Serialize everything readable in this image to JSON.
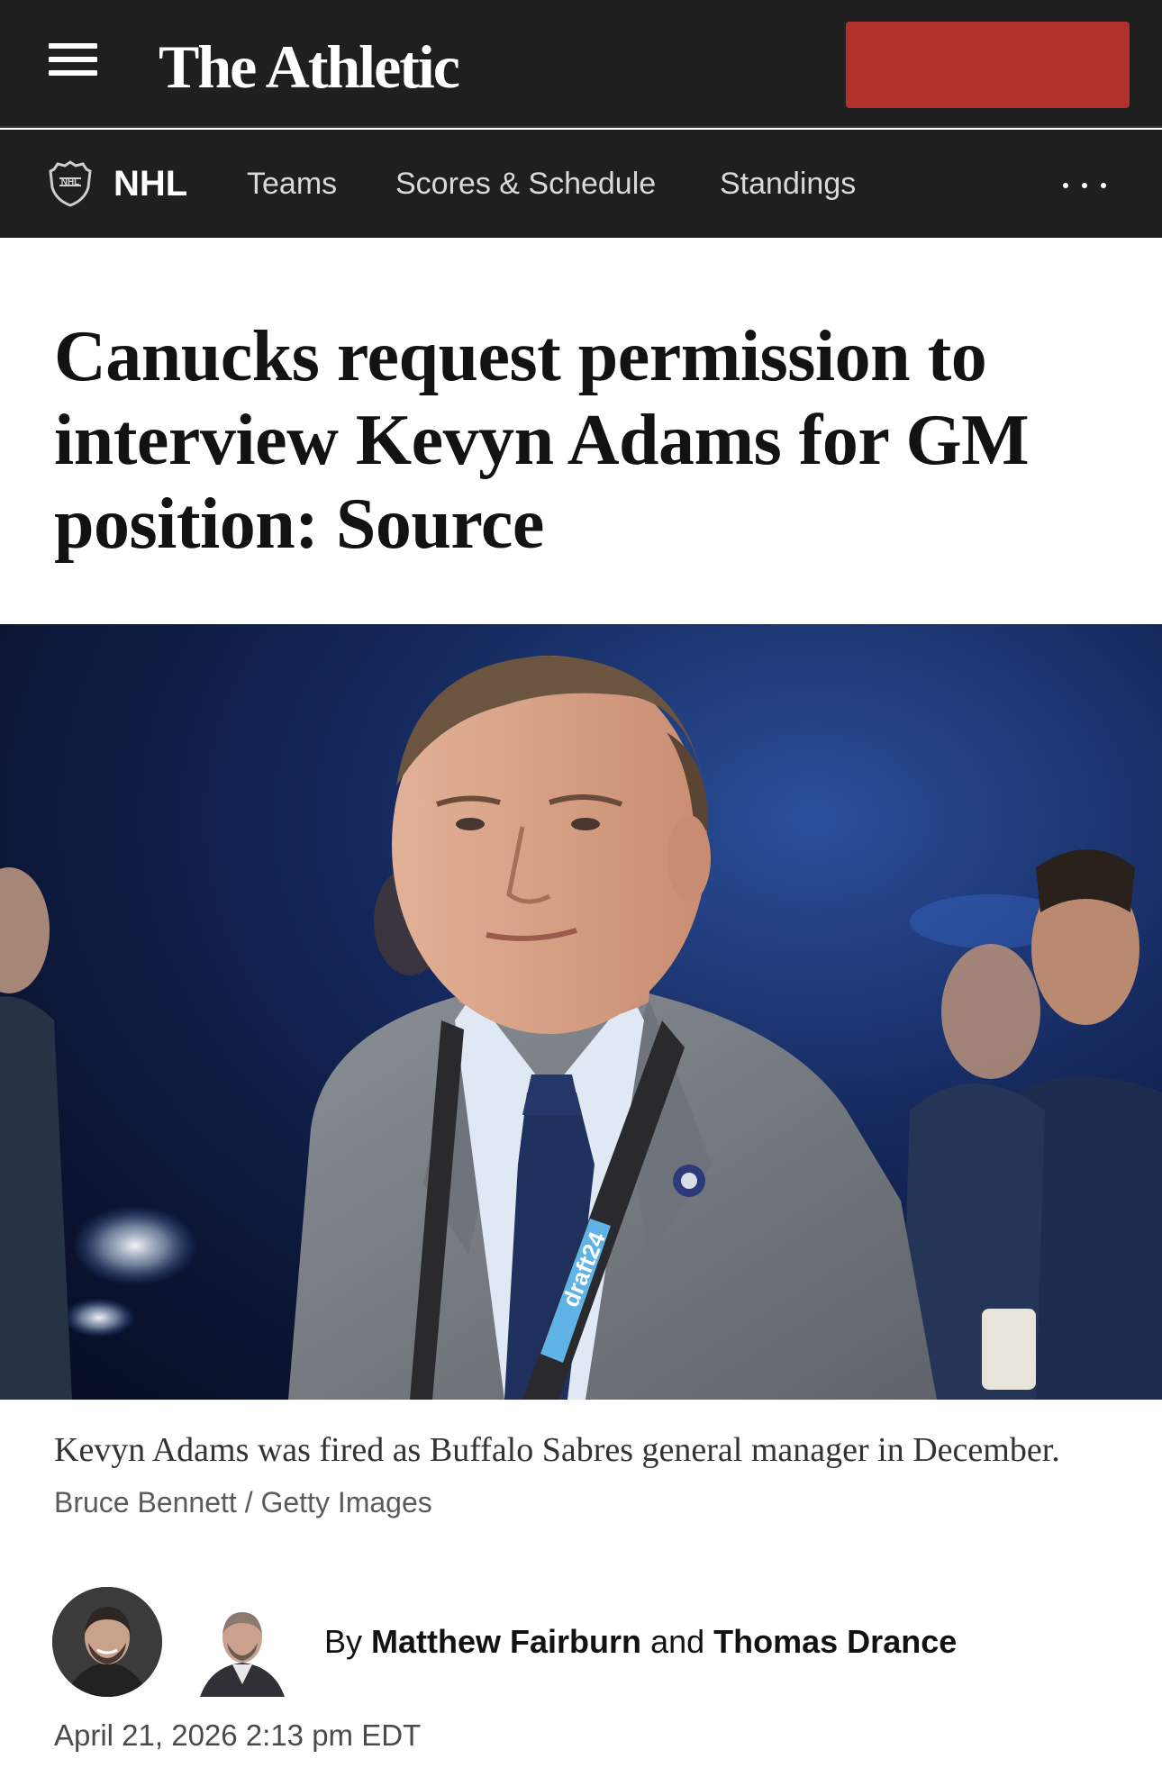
{
  "header": {
    "logo_text": "The Athletic",
    "menu_icon": "hamburger-menu-icon",
    "cta_color": "#b3312c"
  },
  "subnav": {
    "league_icon": "nhl-shield-icon",
    "league": "NHL",
    "items": [
      {
        "label": "Teams"
      },
      {
        "label": "Scores & Schedule"
      },
      {
        "label": "Standings"
      }
    ],
    "more_icon": "more-dots-icon"
  },
  "article": {
    "headline": "Canucks request permission to interview Kevyn Adams for GM position: Source",
    "photo": {
      "caption": "Kevyn Adams was fired as Buffalo Sabres general manager in December.",
      "credit": "Bruce Bennett / Getty Images",
      "lanyard_text": "draft24"
    },
    "byline": {
      "prefix": "By",
      "author1": "Matthew Fairburn",
      "conjunction": "and",
      "author2": "Thomas Drance"
    },
    "timestamp": "April 21, 2026 2:13 pm EDT"
  },
  "colors": {
    "header_bg": "#1f1f1f",
    "accent_red": "#b3312c"
  }
}
